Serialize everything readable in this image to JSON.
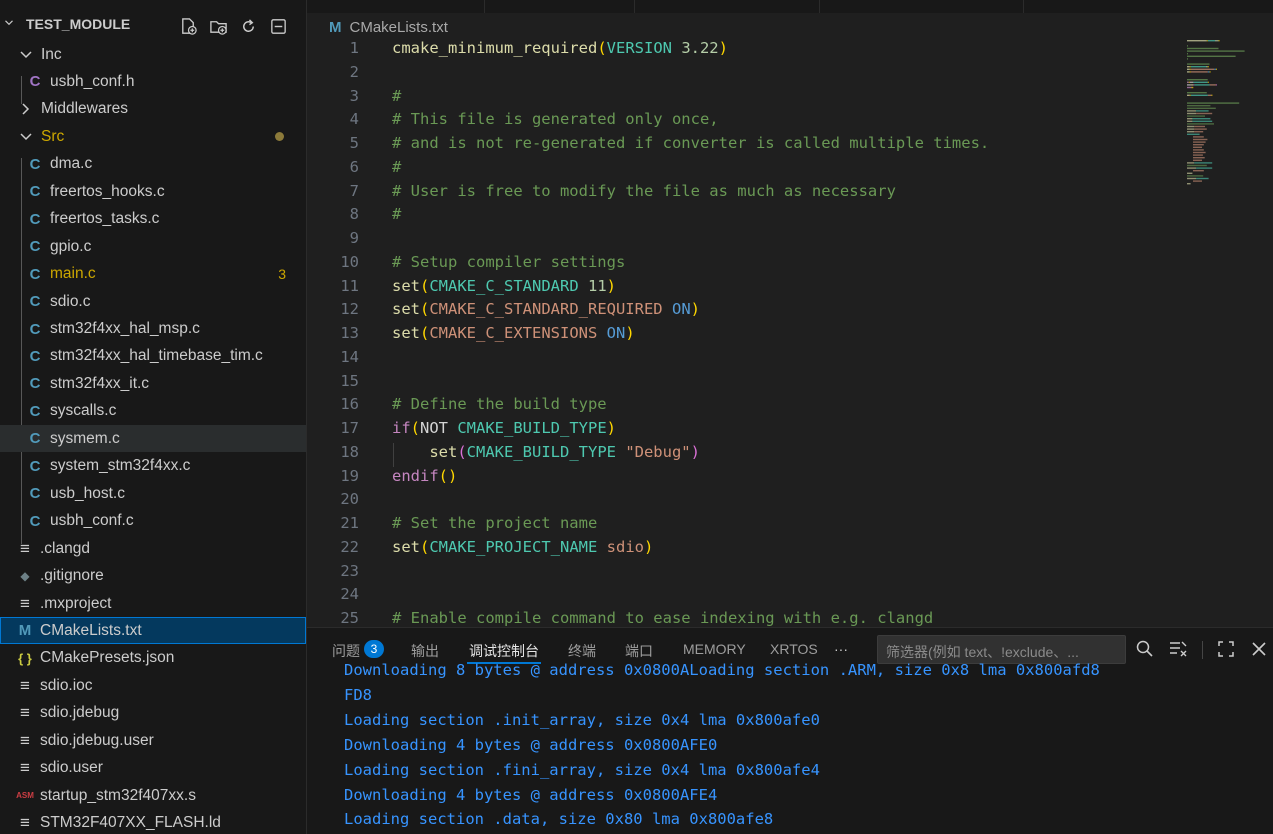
{
  "sidebar": {
    "title": "TEST_MODULE",
    "actions": [
      "new-file-icon",
      "new-folder-icon",
      "refresh-icon",
      "collapse-all-icon"
    ],
    "items": [
      {
        "label": "Inc",
        "kind": "folder",
        "expanded": true
      },
      {
        "label": "usbh_conf.h",
        "kind": "c-header"
      },
      {
        "label": "Middlewares",
        "kind": "folder",
        "expanded": false
      },
      {
        "label": "Src",
        "kind": "folder",
        "expanded": true,
        "modified": true
      },
      {
        "label": "dma.c",
        "kind": "c"
      },
      {
        "label": "freertos_hooks.c",
        "kind": "c"
      },
      {
        "label": "freertos_tasks.c",
        "kind": "c"
      },
      {
        "label": "gpio.c",
        "kind": "c"
      },
      {
        "label": "main.c",
        "kind": "c",
        "problems": "3"
      },
      {
        "label": "sdio.c",
        "kind": "c"
      },
      {
        "label": "stm32f4xx_hal_msp.c",
        "kind": "c"
      },
      {
        "label": "stm32f4xx_hal_timebase_tim.c",
        "kind": "c"
      },
      {
        "label": "stm32f4xx_it.c",
        "kind": "c"
      },
      {
        "label": "syscalls.c",
        "kind": "c"
      },
      {
        "label": "sysmem.c",
        "kind": "c",
        "hover": true
      },
      {
        "label": "system_stm32f4xx.c",
        "kind": "c"
      },
      {
        "label": "usb_host.c",
        "kind": "c"
      },
      {
        "label": "usbh_conf.c",
        "kind": "c"
      },
      {
        "label": ".clangd",
        "kind": "text"
      },
      {
        "label": ".gitignore",
        "kind": "git"
      },
      {
        "label": ".mxproject",
        "kind": "text"
      },
      {
        "label": "CMakeLists.txt",
        "kind": "cmake",
        "selected": true
      },
      {
        "label": "CMakePresets.json",
        "kind": "json"
      },
      {
        "label": "sdio.ioc",
        "kind": "text"
      },
      {
        "label": "sdio.jdebug",
        "kind": "text"
      },
      {
        "label": "sdio.jdebug.user",
        "kind": "text"
      },
      {
        "label": "sdio.user",
        "kind": "text"
      },
      {
        "label": "startup_stm32f407xx.s",
        "kind": "asm"
      },
      {
        "label": "STM32F407XX_FLASH.ld",
        "kind": "text"
      }
    ],
    "icon_glyphs": {
      "c": "C",
      "cmake": "M",
      "json": "{ }",
      "asm": "ASM",
      "text": "≡",
      "git": "◆"
    }
  },
  "editor": {
    "breadcrumb_icon": "M",
    "breadcrumb": "CMakeLists.txt",
    "lines": [
      {
        "n": "1",
        "tokens": [
          [
            "fn",
            "cmake_minimum_required"
          ],
          [
            "p",
            "("
          ],
          [
            "var",
            "VERSION "
          ],
          [
            "num",
            "3.22"
          ],
          [
            "p",
            ")"
          ]
        ]
      },
      {
        "n": "2",
        "tokens": []
      },
      {
        "n": "3",
        "tokens": [
          [
            "cmt",
            "#"
          ]
        ]
      },
      {
        "n": "4",
        "tokens": [
          [
            "cmt",
            "# This file is generated only once,"
          ]
        ]
      },
      {
        "n": "5",
        "tokens": [
          [
            "cmt",
            "# and is not re-generated if converter is called multiple times."
          ]
        ]
      },
      {
        "n": "6",
        "tokens": [
          [
            "cmt",
            "#"
          ]
        ]
      },
      {
        "n": "7",
        "tokens": [
          [
            "cmt",
            "# User is free to modify the file as much as necessary"
          ]
        ]
      },
      {
        "n": "8",
        "tokens": [
          [
            "cmt",
            "#"
          ]
        ]
      },
      {
        "n": "9",
        "tokens": []
      },
      {
        "n": "10",
        "tokens": [
          [
            "cmt",
            "# Setup compiler settings"
          ]
        ]
      },
      {
        "n": "11",
        "tokens": [
          [
            "fn",
            "set"
          ],
          [
            "p",
            "("
          ],
          [
            "var",
            "CMAKE_C_STANDARD "
          ],
          [
            "num",
            "11"
          ],
          [
            "p",
            ")"
          ]
        ]
      },
      {
        "n": "12",
        "tokens": [
          [
            "fn",
            "set"
          ],
          [
            "p",
            "("
          ],
          [
            "str",
            "CMAKE_C_STANDARD_REQUIRED "
          ],
          [
            "const",
            "ON"
          ],
          [
            "p",
            ")"
          ]
        ]
      },
      {
        "n": "13",
        "tokens": [
          [
            "fn",
            "set"
          ],
          [
            "p",
            "("
          ],
          [
            "str",
            "CMAKE_C_EXTENSIONS "
          ],
          [
            "const",
            "ON"
          ],
          [
            "p",
            ")"
          ]
        ]
      },
      {
        "n": "14",
        "tokens": []
      },
      {
        "n": "15",
        "tokens": []
      },
      {
        "n": "16",
        "tokens": [
          [
            "cmt",
            "# Define the build type"
          ]
        ]
      },
      {
        "n": "17",
        "tokens": [
          [
            "kw",
            "if"
          ],
          [
            "p",
            "("
          ],
          [
            "plain",
            "NOT "
          ],
          [
            "var",
            "CMAKE_BUILD_TYPE"
          ],
          [
            "p",
            ")"
          ]
        ]
      },
      {
        "n": "18",
        "tokens": [
          [
            "plain",
            "    "
          ],
          [
            "fn",
            "set"
          ],
          [
            "p2",
            "("
          ],
          [
            "var",
            "CMAKE_BUILD_TYPE "
          ],
          [
            "str",
            "\"Debug\""
          ],
          [
            "p2",
            ")"
          ]
        ]
      },
      {
        "n": "19",
        "tokens": [
          [
            "kw",
            "endif"
          ],
          [
            "p",
            "()"
          ]
        ]
      },
      {
        "n": "20",
        "tokens": []
      },
      {
        "n": "21",
        "tokens": [
          [
            "cmt",
            "# Set the project name"
          ]
        ]
      },
      {
        "n": "22",
        "tokens": [
          [
            "fn",
            "set"
          ],
          [
            "p",
            "("
          ],
          [
            "var",
            "CMAKE_PROJECT_NAME "
          ],
          [
            "str",
            "sdio"
          ],
          [
            "p",
            ")"
          ]
        ]
      },
      {
        "n": "23",
        "tokens": []
      },
      {
        "n": "24",
        "tokens": []
      },
      {
        "n": "25",
        "tokens": [
          [
            "cmt",
            "# Enable compile command to ease indexing with e.g. clangd"
          ]
        ]
      }
    ]
  },
  "panel": {
    "tabs": [
      "问题",
      "输出",
      "调试控制台",
      "终端",
      "端口",
      "MEMORY",
      "XRTOS"
    ],
    "active_tab": "调试控制台",
    "problems_count": "3",
    "more": "···",
    "filter_placeholder": "筛选器(例如 text、!exclude、...",
    "output_lines": [
      "Downloading 8 bytes @ address 0x0800ALoading section .ARM, size 0x8 lma 0x800afd8",
      "FD8",
      "Loading section .init_array, size 0x4 lma 0x800afe0",
      "Downloading 4 bytes @ address 0x0800AFE0",
      "Loading section .fini_array, size 0x4 lma 0x800afe4",
      "Downloading 4 bytes @ address 0x0800AFE4",
      "Loading section .data, size 0x80 lma 0x800afe8"
    ]
  },
  "colors": {
    "accent": "#0078d4",
    "c_icon": "#519aba",
    "cmake_icon": "#519aba",
    "json_icon": "#cbcb41",
    "asm_icon": "#cc3e44",
    "modified": "#cca700",
    "console_text": "#3794ff"
  }
}
